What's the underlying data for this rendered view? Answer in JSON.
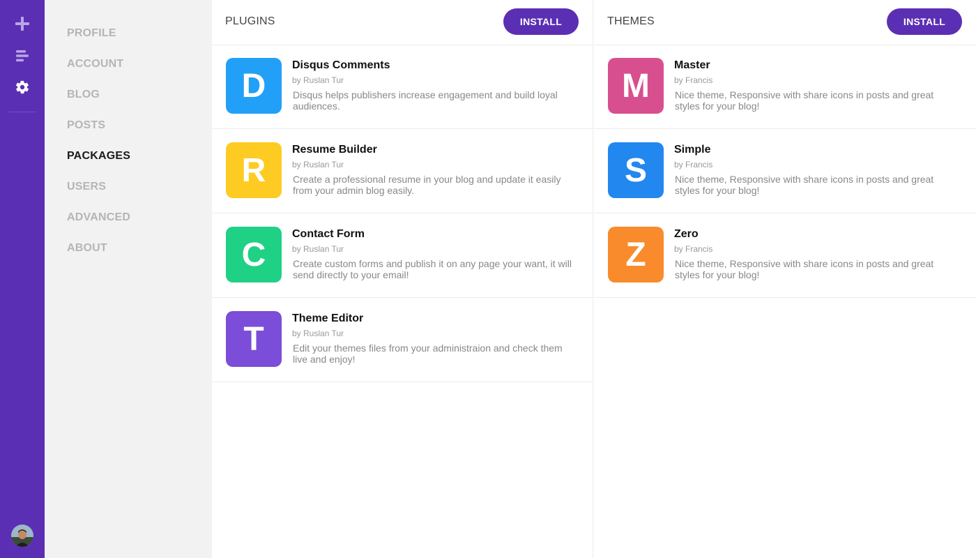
{
  "colors": {
    "accent": "#5b2fb3",
    "sidebar_bg": "#f2f2f2",
    "nav_inactive": "#b5b5b5",
    "nav_active": "#1a1a1a"
  },
  "rail": {
    "icons": [
      "plus-icon",
      "posts-list-icon",
      "gear-icon"
    ]
  },
  "settings_nav": {
    "items": [
      {
        "label": "PROFILE",
        "active": false
      },
      {
        "label": "ACCOUNT",
        "active": false
      },
      {
        "label": "BLOG",
        "active": false
      },
      {
        "label": "POSTS",
        "active": false
      },
      {
        "label": "PACKAGES",
        "active": true
      },
      {
        "label": "USERS",
        "active": false
      },
      {
        "label": "ADVANCED",
        "active": false
      },
      {
        "label": "ABOUT",
        "active": false
      }
    ]
  },
  "plugins": {
    "title": "PLUGINS",
    "install_label": "INSTALL",
    "items": [
      {
        "letter": "D",
        "color": "#22a0f7",
        "name": "Disqus Comments",
        "author": "by Ruslan Tur",
        "description": "Disqus helps publishers increase engagement and build loyal audiences."
      },
      {
        "letter": "R",
        "color": "#fecb23",
        "name": "Resume Builder",
        "author": "by Ruslan Tur",
        "description": "Create a professional resume in your blog and update it easily from your admin blog easily."
      },
      {
        "letter": "C",
        "color": "#1fd185",
        "name": "Contact Form",
        "author": "by Ruslan Tur",
        "description": "Create custom forms and publish it on any page your want, it will send directly to your email!"
      },
      {
        "letter": "T",
        "color": "#7c4dd8",
        "name": "Theme Editor",
        "author": "by Ruslan Tur",
        "description": "Edit your themes files from your administraion and check them live and enjoy!"
      }
    ]
  },
  "themes": {
    "title": "THEMES",
    "install_label": "INSTALL",
    "items": [
      {
        "letter": "M",
        "color": "#d84f8f",
        "name": "Master",
        "author": "by Francis",
        "description": "Nice theme, Responsive with share icons in posts and great styles for your blog!"
      },
      {
        "letter": "S",
        "color": "#2287ef",
        "name": "Simple",
        "author": "by Francis",
        "description": "Nice theme, Responsive with share icons in posts and great styles for your blog!"
      },
      {
        "letter": "Z",
        "color": "#f98b2c",
        "name": "Zero",
        "author": "by Francis",
        "description": "Nice theme, Responsive with share icons in posts and great styles for your blog!"
      }
    ]
  }
}
